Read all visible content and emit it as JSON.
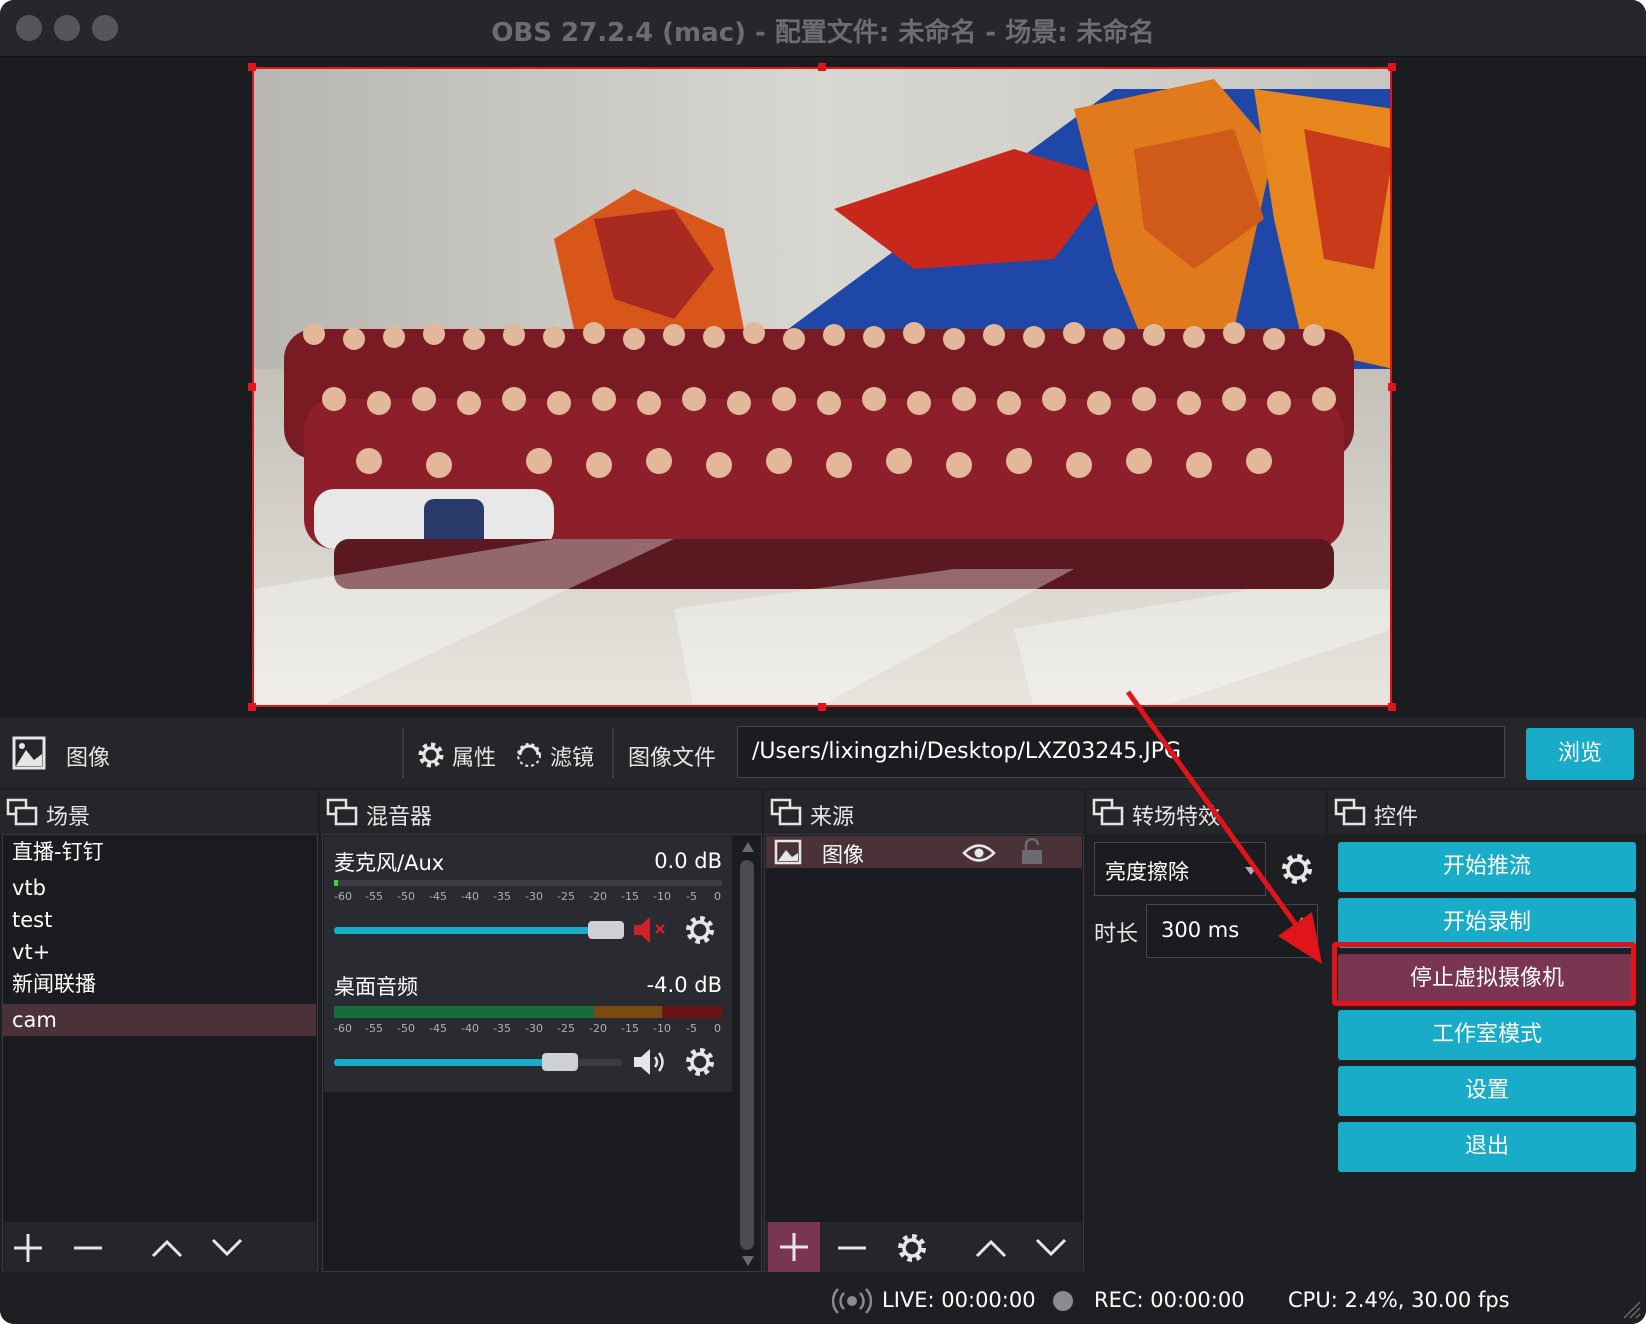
{
  "window": {
    "title": "OBS 27.2.4 (mac) - 配置文件: 未命名 - 场景: 未命名"
  },
  "source_toolbar": {
    "source_name": "图像",
    "properties_label": "属性",
    "filters_label": "滤镜",
    "image_file_label": "图像文件",
    "image_path": "/Users/lixingzhi/Desktop/LXZ03245.JPG",
    "browse_label": "浏览"
  },
  "docks": {
    "scenes_title": "场景",
    "mixer_title": "混音器",
    "sources_title": "来源",
    "transitions_title": "转场特效",
    "controls_title": "控件"
  },
  "scenes": {
    "items": [
      "直播-钉钉",
      "vtb",
      "test",
      "vt+",
      "新闻联播",
      "cam"
    ],
    "selected": "cam"
  },
  "mixer": {
    "tick_labels": [
      "-60",
      "-55",
      "-50",
      "-45",
      "-40",
      "-35",
      "-30",
      "-25",
      "-20",
      "-15",
      "-10",
      "-5",
      "0"
    ],
    "channels": [
      {
        "name": "麦克风/Aux",
        "db": "0.0 dB",
        "volume": 0.93,
        "muted": true
      },
      {
        "name": "桌面音频",
        "db": "-4.0 dB",
        "volume": 0.75,
        "muted": false
      }
    ]
  },
  "sources": {
    "items": [
      {
        "name": "图像",
        "visible": true,
        "locked": false
      }
    ]
  },
  "transitions": {
    "selected_transition": "亮度擦除",
    "duration_label": "时长",
    "duration_value": "300 ms"
  },
  "controls": {
    "start_stream": "开始推流",
    "start_record": "开始录制",
    "stop_virtualcam": "停止虚拟摄像机",
    "studio_mode": "工作室模式",
    "settings": "设置",
    "exit": "退出"
  },
  "status": {
    "live": "LIVE: 00:00:00",
    "rec": "REC: 00:00:00",
    "cpu": "CPU: 2.4%, 30.00 fps"
  },
  "colors": {
    "accent": "#18acc8",
    "highlight_box": "#e0141a",
    "active_button": "#7a3550"
  }
}
